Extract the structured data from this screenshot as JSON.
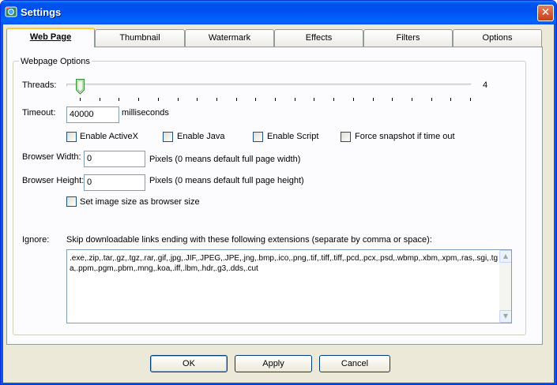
{
  "window": {
    "title": "Settings",
    "close_glyph": "✕",
    "icon": "app-camera-icon"
  },
  "tabs": [
    {
      "label": "Web Page",
      "active": true
    },
    {
      "label": "Thumbnail",
      "active": false
    },
    {
      "label": "Watermark",
      "active": false
    },
    {
      "label": "Effects",
      "active": false
    },
    {
      "label": "Filters",
      "active": false
    },
    {
      "label": "Options",
      "active": false
    }
  ],
  "webpage_options": {
    "group_label": "Webpage Options",
    "threads": {
      "label": "Threads:",
      "value": "4",
      "position": 1,
      "min": 1,
      "max": 21
    },
    "timeout": {
      "label": "Timeout:",
      "value": "40000",
      "unit": "milliseconds"
    },
    "checkboxes": [
      {
        "label": "Enable ActiveX",
        "checked": false
      },
      {
        "label": "Enable Java",
        "checked": false
      },
      {
        "label": "Enable Script",
        "checked": false
      },
      {
        "label": "Force snapshot if time out",
        "checked": false
      }
    ],
    "browser_width": {
      "label": "Browser Width:",
      "value": "0",
      "hint": "Pixels (0 means default full page width)"
    },
    "browser_height": {
      "label": "Browser Height:",
      "value": "0",
      "hint": "Pixels (0 means default full page height)"
    },
    "set_image_size": {
      "label": "Set image size as browser size",
      "checked": false
    },
    "ignore": {
      "label": "Ignore:",
      "description": "Skip downloadable links ending with these following extensions (separate by comma or space):",
      "value": ".exe,.zip,.tar,.gz,.tgz,.rar,.gif,.jpg,.JIF,.JPEG,.JPE,.jng,.bmp,.ico,.png,.tif,.tiff,.tiff,.pcd,.pcx,.psd,.wbmp,.xbm,.xpm,.ras,.sgi,.tga,.ppm,.pgm,.pbm,.mng,.koa,.iff,.lbm,.hdr,.g3,.dds,.cut"
    }
  },
  "buttons": {
    "ok": "OK",
    "apply": "Apply",
    "cancel": "Cancel"
  },
  "colors": {
    "titlebar": "#0053ee",
    "dialog_bg": "#ece9d8",
    "tab_highlight": "#ffc83c",
    "close_button": "#c6401c"
  },
  "scroll_glyphs": {
    "up": "▲",
    "down": "▼"
  }
}
